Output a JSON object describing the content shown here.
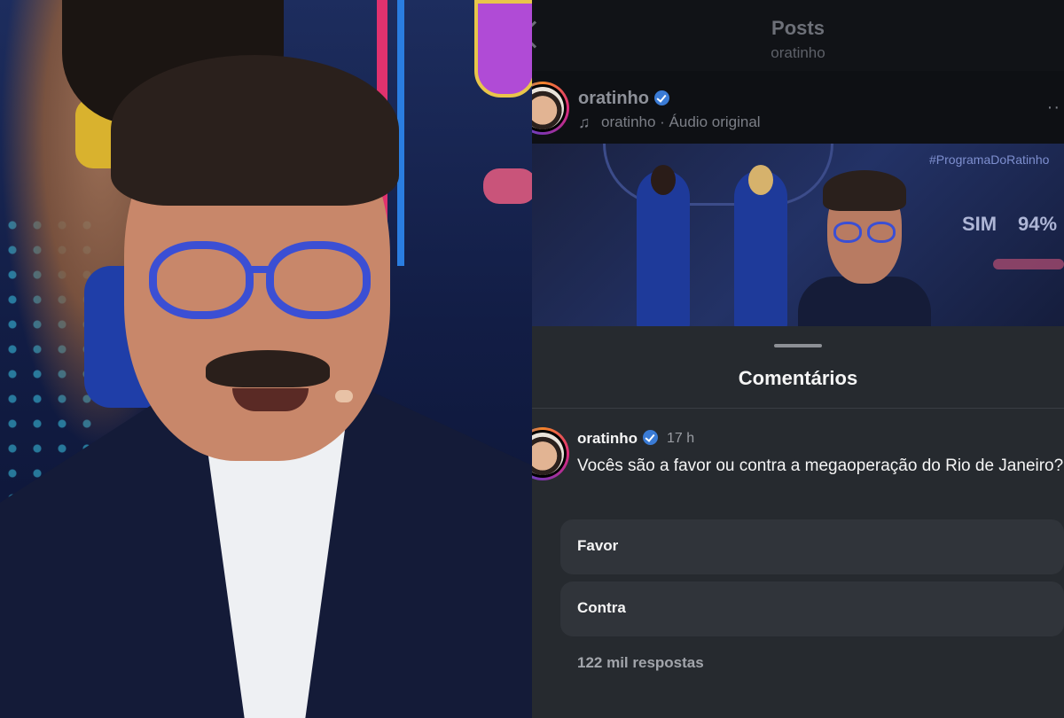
{
  "header": {
    "title": "Posts",
    "subtitle": "oratinho"
  },
  "post": {
    "username": "oratinho",
    "audio": "oratinho · Áudio original",
    "thumbnail": {
      "hashtag": "#ProgramaDoRatinho",
      "poll_label": "SIM",
      "poll_value": "94%"
    }
  },
  "comments": {
    "title": "Comentários",
    "item": {
      "username": "oratinho",
      "time": "17 h",
      "text": "Vocês são a favor ou contra a megaoperação do Rio de Janeiro?"
    },
    "options": [
      "Favor",
      "Contra"
    ],
    "replies": "122 mil respostas"
  },
  "icons": {
    "verified": "verified-badge-icon",
    "music": "music-note-icon",
    "more": "more-icon",
    "back": "back-chevron-icon"
  },
  "colors": {
    "verified": "#3a7bd5",
    "sheet": "#262a2f",
    "option": "#30343a"
  }
}
